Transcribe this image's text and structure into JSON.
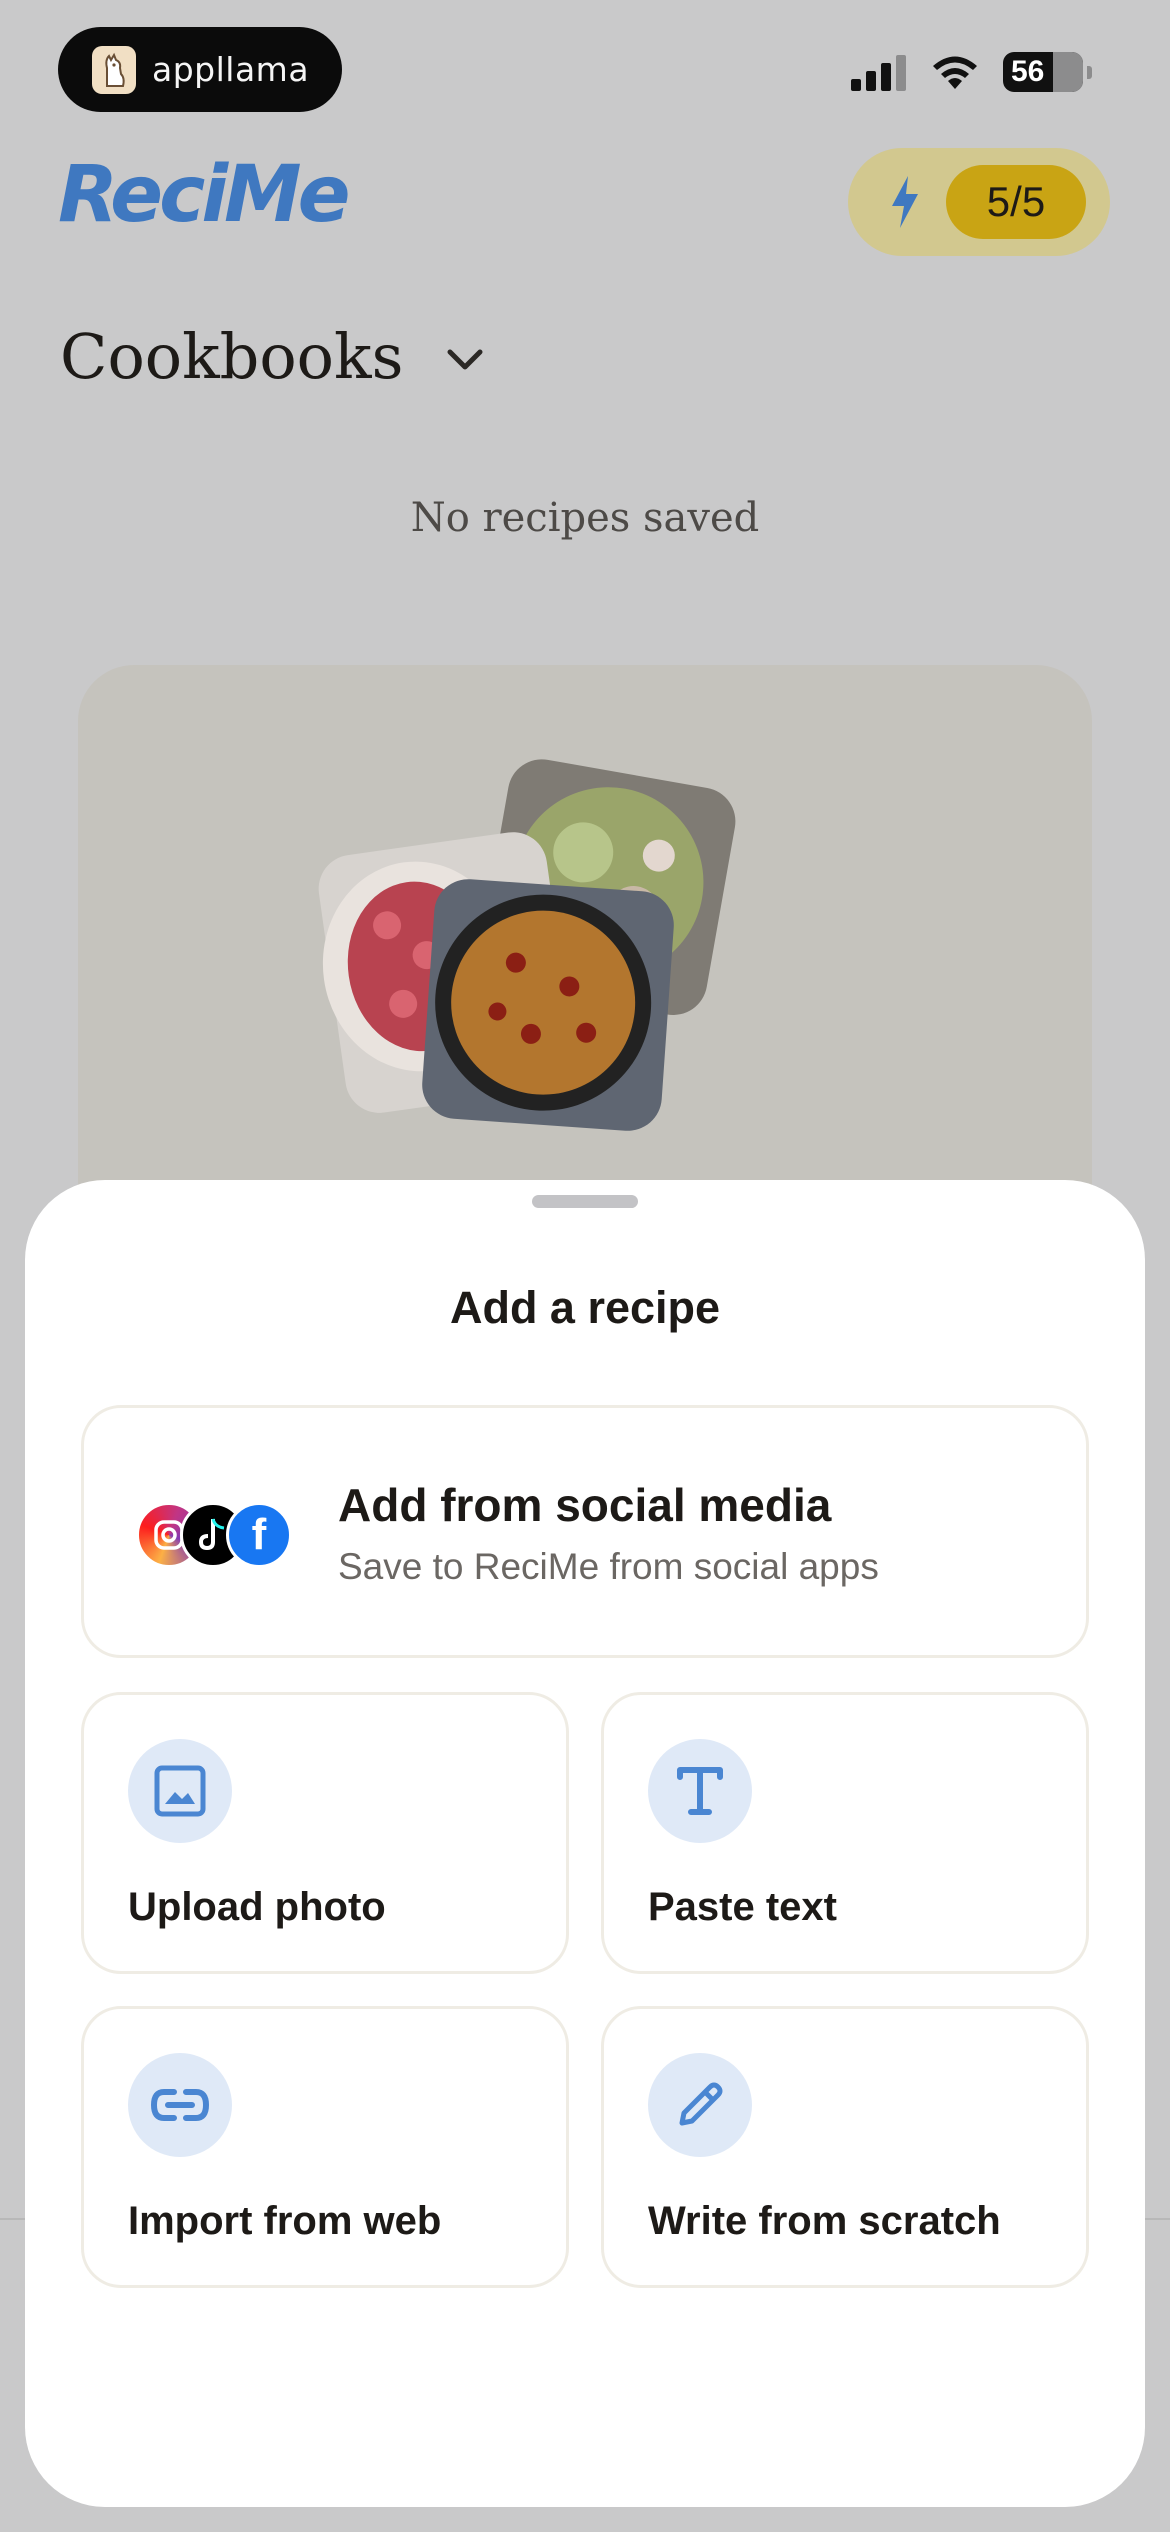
{
  "status_bar": {
    "pill_label": "appllama",
    "battery": "56"
  },
  "header": {
    "logo": "ReciMe",
    "credits": "5/5"
  },
  "cookbooks": {
    "title": "Cookbooks",
    "empty_text": "No recipes saved"
  },
  "sheet": {
    "title": "Add a recipe",
    "social": {
      "title": "Add from social media",
      "subtitle": "Save to ReciMe from social apps",
      "icons": [
        "instagram-icon",
        "tiktok-icon",
        "facebook-icon"
      ]
    },
    "options": [
      {
        "label": "Upload photo",
        "icon": "image-icon"
      },
      {
        "label": "Paste text",
        "icon": "text-icon"
      },
      {
        "label": "Import from web",
        "icon": "link-icon"
      },
      {
        "label": "Write from scratch",
        "icon": "pencil-icon"
      }
    ]
  },
  "colors": {
    "brand": "#3f78c0",
    "credit_badge": "#c9a414",
    "icon_circle": "#dfe9f7",
    "overlay_bg": "#c9c9ca"
  }
}
